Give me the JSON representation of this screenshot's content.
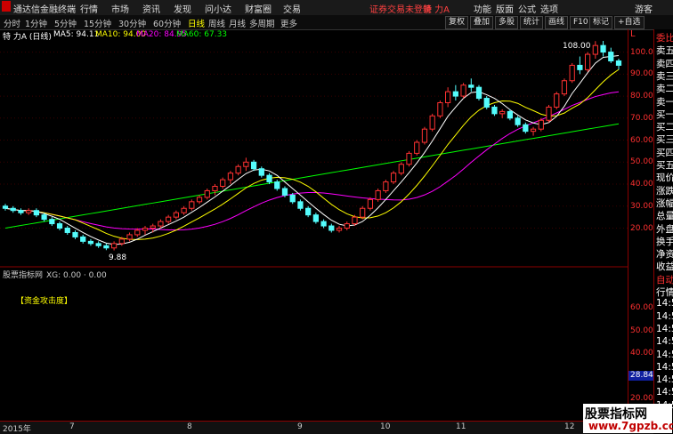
{
  "menubar": {
    "app_title": "通达信金融终端",
    "items": [
      "行情",
      "市场",
      "资讯",
      "发现",
      "问小达",
      "财富圈",
      "交易"
    ],
    "status_msg": "证券交易未登录",
    "stock_name": "特 力A",
    "right_items": [
      "功能",
      "版面",
      "公式",
      "选项"
    ],
    "guest": "游客"
  },
  "toolbar": {
    "periods": [
      "分时",
      "1分钟",
      "5分钟",
      "15分钟",
      "30分钟",
      "60分钟",
      "日线",
      "周线",
      "月线",
      "多周期",
      "更多"
    ],
    "active_period": "日线",
    "right_buttons": [
      "复权",
      "叠加",
      "多股",
      "统计",
      "画线",
      "F10",
      "标记",
      "+自选"
    ]
  },
  "info": {
    "title": "特 力A (日线)",
    "ma5": "MA5: 94.11",
    "ma10": "MA10: 94.00",
    "ma20": "MA20: 84.95",
    "ma60": "MA60: 67.33",
    "colors": {
      "ma5": "#ffffff",
      "ma10": "#ffff00",
      "ma20": "#ff00ff",
      "ma60": "#00ff00"
    }
  },
  "indicator": {
    "title": "股票指标网",
    "value": "XG: 0.00 · 0.00",
    "label": "【资金攻击度】"
  },
  "axis": {
    "price_ticks": [
      "100.00",
      "90.00",
      "80.00",
      "70.00",
      "60.00",
      "50.00",
      "40.00",
      "30.00",
      "20.00"
    ],
    "indicator_ticks": [
      "60.00",
      "50.00",
      "40.00",
      "30.00",
      "20.00",
      "10.00"
    ],
    "current_marker": "28.84",
    "top_label": "L"
  },
  "annotations": {
    "high": "108.00",
    "low": "9.88"
  },
  "right_panel": {
    "items": [
      {
        "t": "委比",
        "c": "red"
      },
      {
        "t": "卖五",
        "c": "w"
      },
      {
        "t": "卖四",
        "c": "w"
      },
      {
        "t": "卖三",
        "c": "w"
      },
      {
        "t": "卖二",
        "c": "w"
      },
      {
        "t": "卖一",
        "c": "w"
      },
      {
        "t": "买一",
        "c": "w"
      },
      {
        "t": "买二",
        "c": "w"
      },
      {
        "t": "买三",
        "c": "w"
      },
      {
        "t": "买四",
        "c": "w"
      },
      {
        "t": "买五",
        "c": "w"
      },
      {
        "t": "现价",
        "c": "w"
      },
      {
        "t": "涨跌",
        "c": "w"
      },
      {
        "t": "涨幅",
        "c": "w"
      },
      {
        "t": "总量",
        "c": "w"
      },
      {
        "t": "外盘",
        "c": "w"
      },
      {
        "t": "换手",
        "c": "w"
      },
      {
        "t": "净资",
        "c": "w"
      },
      {
        "t": "收益",
        "c": "w"
      },
      {
        "t": "自动",
        "c": "red"
      },
      {
        "t": "行情",
        "c": "w"
      },
      {
        "t": "14:50",
        "c": "w"
      },
      {
        "t": "14:50",
        "c": "w"
      },
      {
        "t": "14:50",
        "c": "w"
      },
      {
        "t": "14:50",
        "c": "w"
      },
      {
        "t": "14:50",
        "c": "w"
      },
      {
        "t": "14:50",
        "c": "w"
      },
      {
        "t": "14:50",
        "c": "w"
      },
      {
        "t": "14:50",
        "c": "w"
      },
      {
        "t": "14:50",
        "c": "w"
      }
    ]
  },
  "bottombar": {
    "year": "2015年",
    "months": [
      "7",
      "8",
      "9",
      "10",
      "11",
      "12"
    ]
  },
  "watermark": {
    "line1": "股票指标网",
    "line2": "www.7gpzb.com"
  },
  "chart_data": {
    "type": "candlestick",
    "ylim": [
      0,
      110
    ],
    "ma_periods": [
      5,
      10,
      20,
      60
    ],
    "ohlc": [
      [
        30,
        31,
        28,
        29
      ],
      [
        29,
        30,
        27,
        28
      ],
      [
        28,
        29,
        26,
        27
      ],
      [
        27,
        29,
        26,
        28
      ],
      [
        28,
        29,
        25,
        26
      ],
      [
        26,
        27,
        23,
        24
      ],
      [
        24,
        25,
        21,
        22
      ],
      [
        22,
        23,
        19,
        20
      ],
      [
        20,
        21,
        17,
        18
      ],
      [
        18,
        19,
        15,
        16
      ],
      [
        16,
        17,
        13,
        14
      ],
      [
        14,
        15,
        12,
        13
      ],
      [
        13,
        14,
        11,
        12
      ],
      [
        12,
        13,
        10,
        11
      ],
      [
        11,
        14,
        9.88,
        13
      ],
      [
        13,
        16,
        12,
        15
      ],
      [
        15,
        18,
        14,
        17
      ],
      [
        17,
        20,
        16,
        19
      ],
      [
        19,
        21,
        17,
        20
      ],
      [
        20,
        22,
        18,
        21
      ],
      [
        21,
        24,
        20,
        23
      ],
      [
        23,
        26,
        22,
        25
      ],
      [
        25,
        28,
        24,
        27
      ],
      [
        27,
        30,
        26,
        29
      ],
      [
        29,
        33,
        28,
        32
      ],
      [
        32,
        35,
        31,
        34
      ],
      [
        34,
        38,
        33,
        37
      ],
      [
        37,
        40,
        35,
        39
      ],
      [
        39,
        43,
        38,
        42
      ],
      [
        42,
        46,
        40,
        45
      ],
      [
        45,
        49,
        44,
        48
      ],
      [
        48,
        52,
        46,
        50
      ],
      [
        50,
        51,
        46,
        47
      ],
      [
        47,
        48,
        43,
        44
      ],
      [
        44,
        45,
        40,
        41
      ],
      [
        41,
        42,
        37,
        38
      ],
      [
        38,
        39,
        34,
        35
      ],
      [
        35,
        36,
        31,
        32
      ],
      [
        32,
        33,
        28,
        29
      ],
      [
        29,
        30,
        25,
        26
      ],
      [
        26,
        27,
        22,
        23
      ],
      [
        23,
        24,
        20,
        21
      ],
      [
        21,
        22,
        18,
        19
      ],
      [
        19,
        21,
        18,
        20
      ],
      [
        20,
        23,
        19,
        22
      ],
      [
        22,
        26,
        21,
        25
      ],
      [
        25,
        30,
        24,
        29
      ],
      [
        29,
        34,
        28,
        33
      ],
      [
        33,
        38,
        32,
        37
      ],
      [
        37,
        42,
        36,
        41
      ],
      [
        41,
        46,
        40,
        45
      ],
      [
        45,
        50,
        44,
        49
      ],
      [
        49,
        55,
        48,
        54
      ],
      [
        54,
        60,
        53,
        59
      ],
      [
        59,
        66,
        58,
        65
      ],
      [
        65,
        72,
        64,
        71
      ],
      [
        71,
        78,
        70,
        77
      ],
      [
        77,
        84,
        75,
        82
      ],
      [
        82,
        85,
        78,
        80
      ],
      [
        80,
        86,
        79,
        85
      ],
      [
        85,
        88,
        82,
        84
      ],
      [
        84,
        85,
        78,
        79
      ],
      [
        79,
        80,
        74,
        75
      ],
      [
        75,
        76,
        71,
        72
      ],
      [
        72,
        74,
        70,
        73
      ],
      [
        73,
        74,
        69,
        70
      ],
      [
        70,
        71,
        66,
        67
      ],
      [
        67,
        68,
        63,
        64
      ],
      [
        64,
        66,
        62,
        65
      ],
      [
        65,
        70,
        64,
        69
      ],
      [
        69,
        76,
        68,
        75
      ],
      [
        75,
        82,
        74,
        81
      ],
      [
        81,
        88,
        80,
        87
      ],
      [
        87,
        95,
        86,
        94
      ],
      [
        94,
        98,
        90,
        92
      ],
      [
        92,
        100,
        91,
        99
      ],
      [
        99,
        105,
        97,
        103
      ],
      [
        103,
        108,
        98,
        100
      ],
      [
        100,
        102,
        95,
        96
      ],
      [
        96,
        97,
        92,
        94
      ]
    ]
  }
}
